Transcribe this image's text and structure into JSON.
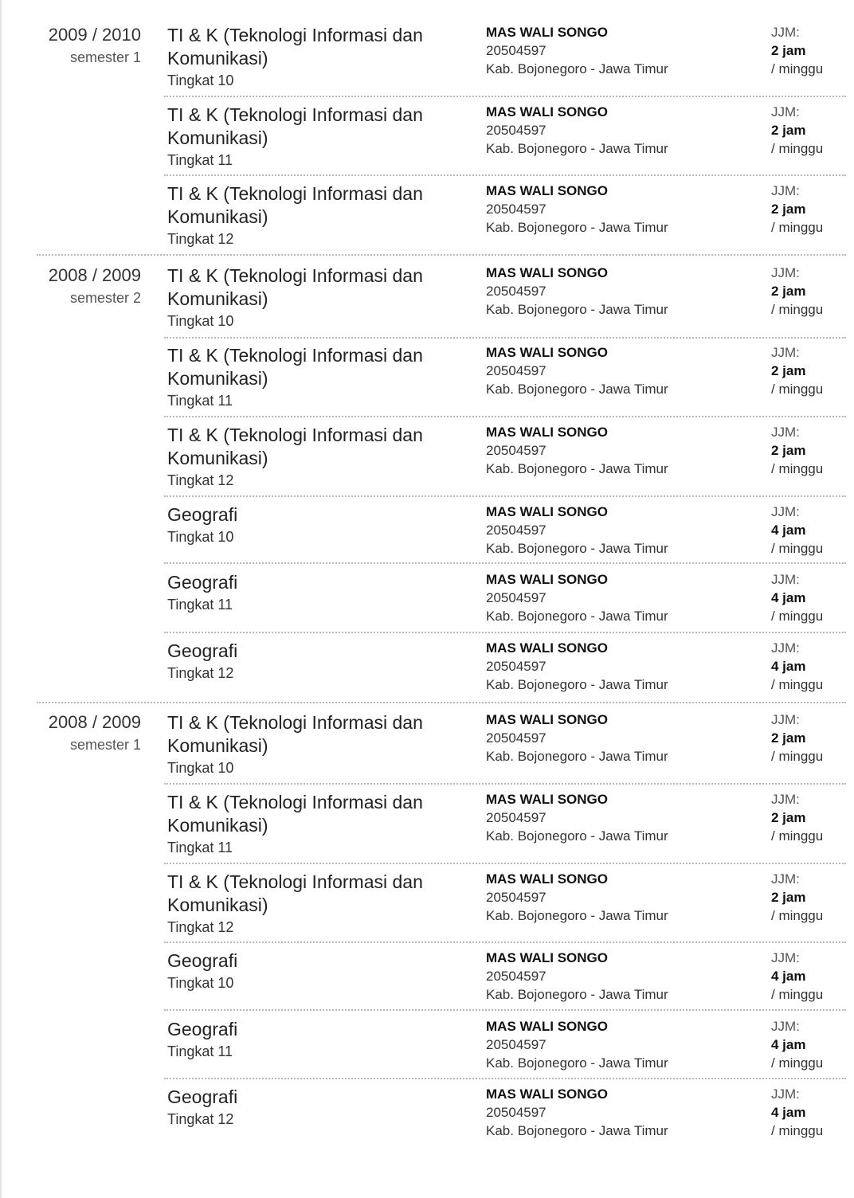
{
  "labels": {
    "jjm": "JJM:",
    "per_week": "/ minggu"
  },
  "groups": [
    {
      "year": "2009 / 2010",
      "semester": "semester 1",
      "entries": [
        {
          "subject": "TI & K (Teknologi Informasi dan Komunikasi)",
          "level": "Tingkat 10",
          "school": "MAS WALI SONGO",
          "npsn": "20504597",
          "region": "Kab. Bojonegoro - Jawa Timur",
          "hours": "2 jam"
        },
        {
          "subject": "TI & K (Teknologi Informasi dan Komunikasi)",
          "level": "Tingkat 11",
          "school": "MAS WALI SONGO",
          "npsn": "20504597",
          "region": "Kab. Bojonegoro - Jawa Timur",
          "hours": "2 jam"
        },
        {
          "subject": "TI & K (Teknologi Informasi dan Komunikasi)",
          "level": "Tingkat 12",
          "school": "MAS WALI SONGO",
          "npsn": "20504597",
          "region": "Kab. Bojonegoro - Jawa Timur",
          "hours": "2 jam"
        }
      ]
    },
    {
      "year": "2008 / 2009",
      "semester": "semester 2",
      "entries": [
        {
          "subject": "TI & K (Teknologi Informasi dan Komunikasi)",
          "level": "Tingkat 10",
          "school": "MAS WALI SONGO",
          "npsn": "20504597",
          "region": "Kab. Bojonegoro - Jawa Timur",
          "hours": "2 jam"
        },
        {
          "subject": "TI & K (Teknologi Informasi dan Komunikasi)",
          "level": "Tingkat 11",
          "school": "MAS WALI SONGO",
          "npsn": "20504597",
          "region": "Kab. Bojonegoro - Jawa Timur",
          "hours": "2 jam"
        },
        {
          "subject": "TI & K (Teknologi Informasi dan Komunikasi)",
          "level": "Tingkat 12",
          "school": "MAS WALI SONGO",
          "npsn": "20504597",
          "region": "Kab. Bojonegoro - Jawa Timur",
          "hours": "2 jam"
        },
        {
          "subject": "Geografi",
          "level": "Tingkat 10",
          "school": "MAS WALI SONGO",
          "npsn": "20504597",
          "region": "Kab. Bojonegoro - Jawa Timur",
          "hours": "4 jam"
        },
        {
          "subject": "Geografi",
          "level": "Tingkat 11",
          "school": "MAS WALI SONGO",
          "npsn": "20504597",
          "region": "Kab. Bojonegoro - Jawa Timur",
          "hours": "4 jam"
        },
        {
          "subject": "Geografi",
          "level": "Tingkat 12",
          "school": "MAS WALI SONGO",
          "npsn": "20504597",
          "region": "Kab. Bojonegoro - Jawa Timur",
          "hours": "4 jam"
        }
      ]
    },
    {
      "year": "2008 / 2009",
      "semester": "semester 1",
      "entries": [
        {
          "subject": "TI & K (Teknologi Informasi dan Komunikasi)",
          "level": "Tingkat 10",
          "school": "MAS WALI SONGO",
          "npsn": "20504597",
          "region": "Kab. Bojonegoro - Jawa Timur",
          "hours": "2 jam"
        },
        {
          "subject": "TI & K (Teknologi Informasi dan Komunikasi)",
          "level": "Tingkat 11",
          "school": "MAS WALI SONGO",
          "npsn": "20504597",
          "region": "Kab. Bojonegoro - Jawa Timur",
          "hours": "2 jam"
        },
        {
          "subject": "TI & K (Teknologi Informasi dan Komunikasi)",
          "level": "Tingkat 12",
          "school": "MAS WALI SONGO",
          "npsn": "20504597",
          "region": "Kab. Bojonegoro - Jawa Timur",
          "hours": "2 jam"
        },
        {
          "subject": "Geografi",
          "level": "Tingkat 10",
          "school": "MAS WALI SONGO",
          "npsn": "20504597",
          "region": "Kab. Bojonegoro - Jawa Timur",
          "hours": "4 jam"
        },
        {
          "subject": "Geografi",
          "level": "Tingkat 11",
          "school": "MAS WALI SONGO",
          "npsn": "20504597",
          "region": "Kab. Bojonegoro - Jawa Timur",
          "hours": "4 jam"
        },
        {
          "subject": "Geografi",
          "level": "Tingkat 12",
          "school": "MAS WALI SONGO",
          "npsn": "20504597",
          "region": "Kab. Bojonegoro - Jawa Timur",
          "hours": "4 jam"
        }
      ]
    }
  ]
}
